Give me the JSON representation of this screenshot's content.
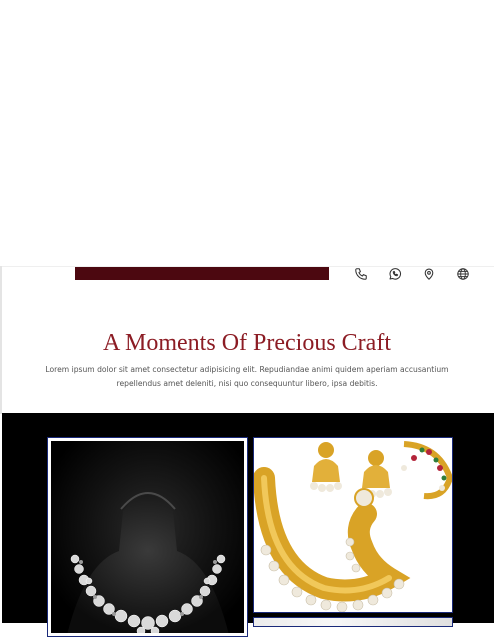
{
  "header": {
    "icons": [
      "phone-icon",
      "whatsapp-icon",
      "location-icon",
      "globe-icon"
    ],
    "brand_color": "#4c0810"
  },
  "section": {
    "title": "A Moments Of Precious Craft",
    "description": "Lorem ipsum dolor sit amet consectetur adipisicing elit. Repudiandae animi quidem aperiam accusantium repellendus amet deleniti, nisi quo consequuntur libero, ipsa debitis.",
    "title_color": "#8c1c24"
  },
  "gallery": {
    "items": [
      {
        "image": "silver-necklace-image"
      },
      {
        "image": "gold-necklace-set-image"
      },
      {
        "image": "jewelry-image"
      }
    ]
  }
}
